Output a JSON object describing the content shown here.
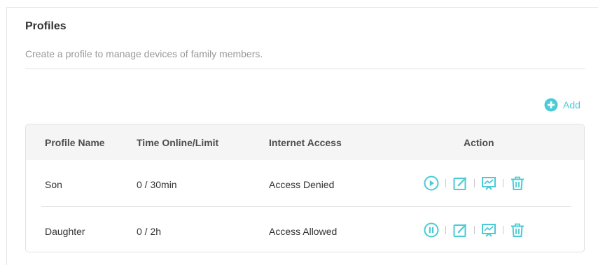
{
  "section": {
    "title": "Profiles",
    "subtitle": "Create a profile to manage devices of family members."
  },
  "add": {
    "label": "Add"
  },
  "table": {
    "headers": [
      "Profile Name",
      "Time Online/Limit",
      "Internet Access",
      "Action"
    ],
    "rows": [
      {
        "name": "Son",
        "time": "0 / 30min",
        "access": "Access Denied",
        "state_icon": "play-icon"
      },
      {
        "name": "Daughter",
        "time": "0 / 2h",
        "access": "Access Allowed",
        "state_icon": "pause-icon"
      }
    ]
  },
  "colors": {
    "accent": "#4acbd6",
    "title_text": "#333333",
    "muted_text": "#999999",
    "header_bg": "#f5f5f5",
    "border": "#e2e2e2"
  }
}
